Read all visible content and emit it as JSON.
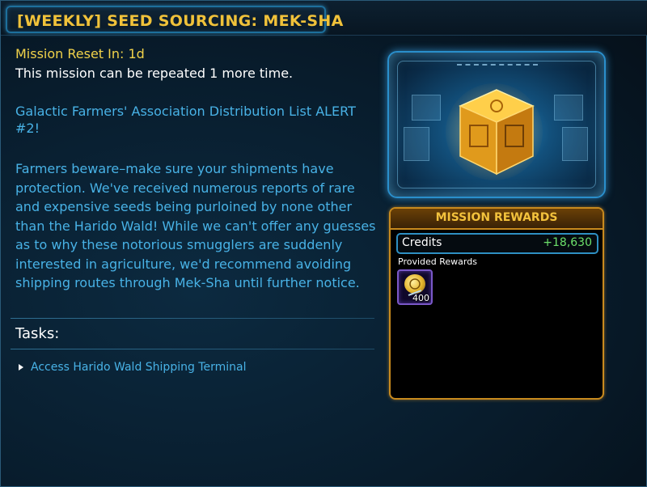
{
  "mission": {
    "title": "[WEEKLY] SEED SOURCING: MEK-SHA",
    "reset": "Mission Reset In: 1d",
    "repeat": "This mission can be repeated 1 more time.",
    "alert": "Galactic Farmers' Association Distribution List ALERT #2!",
    "body": "Farmers beware–make sure your shipments have protection. We've received numerous reports of rare and expensive seeds being purloined by none other than the Harido Wald! While we can't offer any guesses as to why these notorious smugglers are suddenly interested in agriculture, we'd recommend avoiding shipping routes through Mek-Sha until further notice."
  },
  "tasks": {
    "heading": "Tasks:",
    "items": [
      {
        "label": "Access Harido Wald Shipping Terminal"
      }
    ]
  },
  "rewards": {
    "title": "MISSION REWARDS",
    "credits_label": "Credits",
    "credits_value": "+18,630",
    "provided_label": "Provided Rewards",
    "item": {
      "icon": "gold-coin-icon",
      "count": "400"
    }
  },
  "colors": {
    "title": "#f0c23a",
    "body": "#48b2e6",
    "reward_border": "#c88a1e",
    "credits": "#6ce06a"
  }
}
